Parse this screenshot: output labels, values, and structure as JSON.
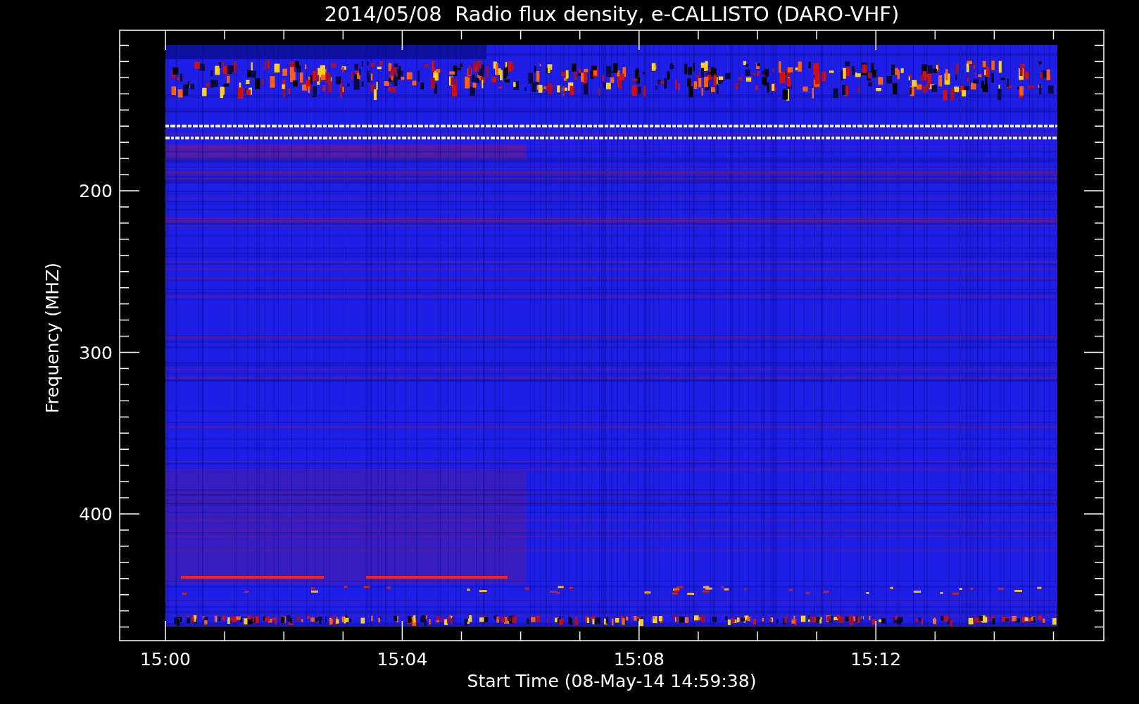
{
  "title": "2014/05/08  Radio flux density, e-CALLISTO (DARO-VHF)",
  "y_axis": {
    "label": "Frequency (MHZ)",
    "ticks": [
      "200",
      "300",
      "400"
    ]
  },
  "x_axis": {
    "label": "Start Time (08-May-14 14:59:38)",
    "ticks": [
      "15:00",
      "15:04",
      "15:08",
      "15:12"
    ]
  }
}
